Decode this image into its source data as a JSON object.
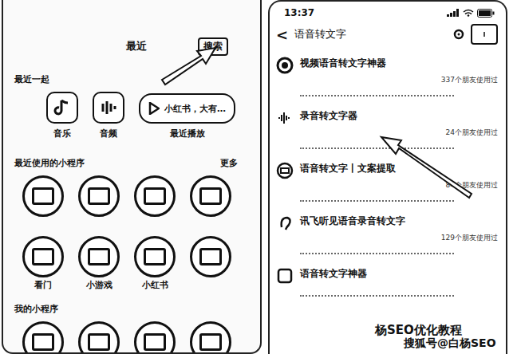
{
  "left_panel": {
    "recent_label": "最近",
    "search_button": "搜索",
    "section_label": "最近一起",
    "apps": [
      {
        "label": "音乐"
      },
      {
        "label": "音频"
      }
    ],
    "pill": {
      "text": "小红书，大有…",
      "label": "最近播放"
    },
    "mini_section": {
      "title": "最近使用的小程序",
      "more": "更多"
    },
    "mini_programs": [
      {
        "label": null
      },
      {
        "label": null
      },
      {
        "label": null
      },
      {
        "label": null
      },
      {
        "label": "看门"
      },
      {
        "label": "小游戏"
      },
      {
        "label": "小红书"
      },
      {
        "label": null
      }
    ],
    "my_section": "我的小程序",
    "my_programs": [
      {
        "label": null
      },
      {
        "label": null
      },
      {
        "label": null
      },
      {
        "label": null
      }
    ]
  },
  "right_panel": {
    "time": "13:37",
    "back": "<",
    "title": "语音转文字",
    "results": [
      {
        "name": "视频语音转文字神器",
        "count": "337个朋友使用过"
      },
      {
        "name": "录音转文字器",
        "count": "24个朋友使用过"
      },
      {
        "name": "语音转文字丨文案提取",
        "count": "84个朋友使用过"
      },
      {
        "name": "讯飞听见语音录音转文字",
        "count": "129个朋友使用过"
      },
      {
        "name": "语音转文字神器",
        "count": ""
      }
    ]
  },
  "watermarks": [
    "杨SEO优化教程",
    "搜狐号@白杨SEO"
  ]
}
